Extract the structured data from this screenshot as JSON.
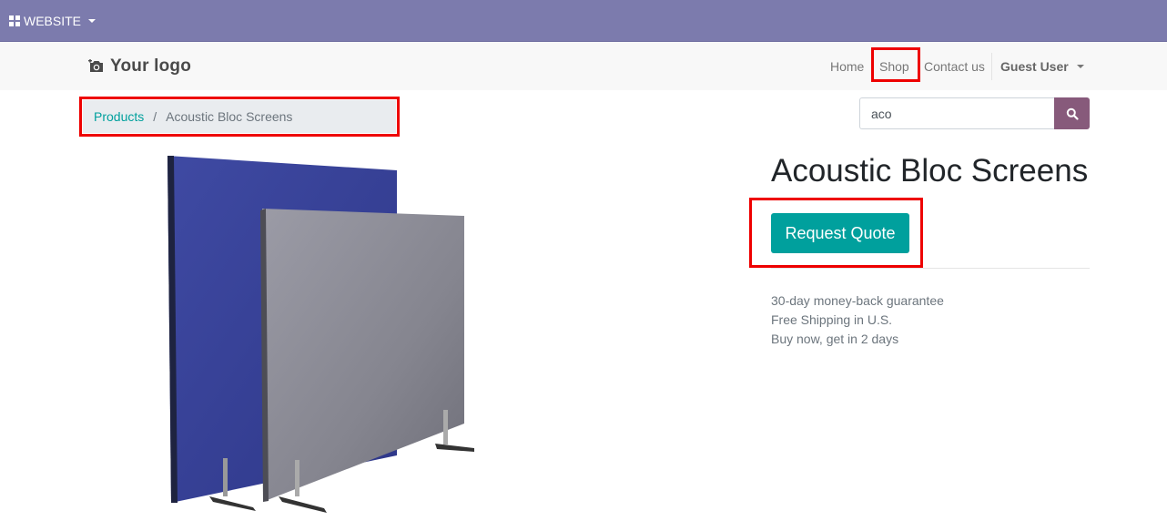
{
  "admin_bar": {
    "menu_label": "WEBSITE",
    "icon": "grid-icon",
    "color": "#7c7bad"
  },
  "header": {
    "logo_icon": "camera-icon",
    "logo_text": "Your logo",
    "nav": [
      {
        "label": "Home"
      },
      {
        "label": "Shop"
      },
      {
        "label": "Contact us"
      }
    ],
    "user_label": "Guest User"
  },
  "breadcrumb": {
    "parent": "Products",
    "separator": "/",
    "current": "Acoustic Bloc Screens"
  },
  "search": {
    "value": "aco",
    "icon": "search-icon",
    "button_color": "#875a7b"
  },
  "product": {
    "title": "Acoustic Bloc Screens",
    "button_label": "Request Quote",
    "button_color": "#00a09d",
    "benefits": [
      "30-day money-back guarantee",
      "Free Shipping in U.S.",
      "Buy now, get in 2 days"
    ]
  },
  "highlight_color": "#ee0000"
}
